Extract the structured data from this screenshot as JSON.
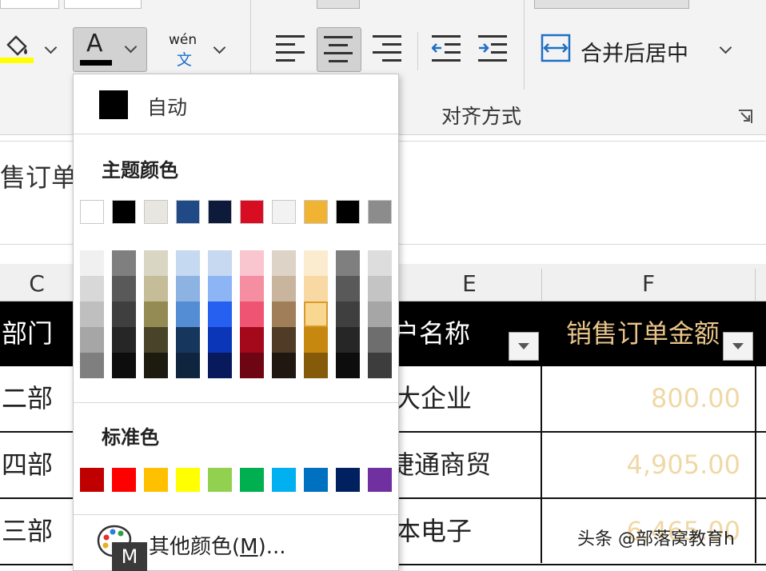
{
  "ribbon": {
    "phonetic_top": "wén",
    "phonetic_bottom": "文",
    "font_color_letter": "A",
    "merge_label": "合并后居中",
    "group_label": "对齐方式"
  },
  "formula_bar": {
    "text": "售订单"
  },
  "columns": [
    "C",
    "E",
    "F"
  ],
  "table": {
    "header_c": "部门",
    "header_e": "户名称",
    "header_f": "销售订单金额",
    "rows": [
      {
        "c": "二部",
        "e": "大企业",
        "f": "800.00"
      },
      {
        "c": "四部",
        "e": "捷通商贸",
        "f": "4,905.00"
      },
      {
        "c": "三部",
        "e": "本电子",
        "f": "6,465.00"
      }
    ]
  },
  "menu": {
    "auto_label": "自动",
    "theme_title": "主题颜色",
    "standard_title": "标准色",
    "more_colors_prefix": "其他颜色(",
    "more_colors_key": "M",
    "more_colors_suffix": ")...",
    "tooltip_key": "M",
    "theme_colors": [
      "#ffffff",
      "#000000",
      "#e8e6e0",
      "#1f4a85",
      "#0d1a3a",
      "#d90d21",
      "#f2f2f2",
      "#f0b432",
      "#000000",
      "#8c8c8c"
    ],
    "tints": [
      [
        "#f0f0f0",
        "#d8d8d8",
        "#bfbfbf",
        "#a6a6a6",
        "#7f7f7f"
      ],
      [
        "#7f7f7f",
        "#595959",
        "#3f3f3f",
        "#262626",
        "#0d0d0d"
      ],
      [
        "#d9d6c3",
        "#c5bd97",
        "#948a54",
        "#494429",
        "#1d1b10"
      ],
      [
        "#c5d9f1",
        "#8db3e2",
        "#548dd4",
        "#17365d",
        "#0f243e"
      ],
      [
        "#c6d9f1",
        "#8db4f5",
        "#2660f0",
        "#0b36b8",
        "#081a5c"
      ],
      [
        "#f9c6cf",
        "#f48ea0",
        "#ef5572",
        "#a3091b",
        "#6d0612"
      ],
      [
        "#ddd3c7",
        "#c9b59d",
        "#a07e5a",
        "#4f3b26",
        "#1f1710"
      ],
      [
        "#fbecd0",
        "#f8d9a3",
        "#f8d790",
        "#c78810",
        "#855a09"
      ],
      [
        "#7f7f7f",
        "#595959",
        "#3f3f3f",
        "#262626",
        "#0d0d0d"
      ],
      [
        "#dddddd",
        "#c4c4c4",
        "#a6a6a6",
        "#6e6e6e",
        "#3d3d3d"
      ]
    ],
    "standard_colors": [
      "#c00000",
      "#ff0000",
      "#ffc000",
      "#ffff00",
      "#92d050",
      "#00b050",
      "#00b0f0",
      "#0070c0",
      "#002060",
      "#7030a0"
    ]
  },
  "watermark": "头条 @部落窝教育h"
}
